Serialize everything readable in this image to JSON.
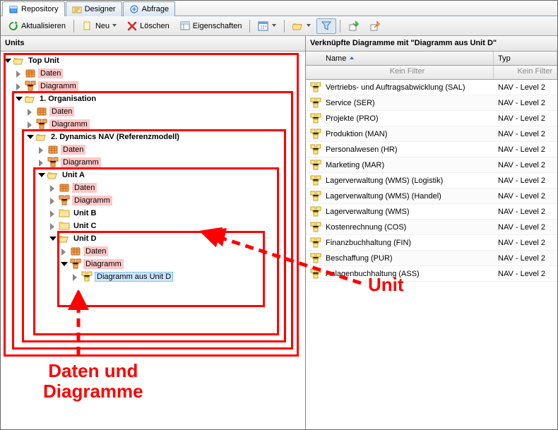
{
  "tabs": [
    {
      "label": "Repository",
      "active": true
    },
    {
      "label": "Designer",
      "active": false
    },
    {
      "label": "Abfrage",
      "active": false
    }
  ],
  "toolbar": {
    "refresh": "Aktualisieren",
    "new": "Neu",
    "delete": "Löschen",
    "props": "Eigenschaften"
  },
  "left": {
    "title": "Units",
    "tree": {
      "topUnit": "Top Unit",
      "daten": "Daten",
      "diagramm": "Diagramm",
      "org": "1. Organisation",
      "nav": "2. Dynamics NAV (Referenzmodell)",
      "unitA": "Unit A",
      "unitB": "Unit B",
      "unitC": "Unit C",
      "unitD": "Unit D",
      "diagFromD": "Diagramm aus Unit D"
    }
  },
  "right": {
    "title": "Verknüpfte Diagramme mit \"Diagramm aus Unit D\"",
    "colName": "Name",
    "colTyp": "Typ",
    "filterText": "Kein Filter",
    "rows": [
      {
        "name": "Vertriebs- und Auftragsabwicklung (SAL)",
        "typ": "NAV - Level 2"
      },
      {
        "name": "Service (SER)",
        "typ": "NAV - Level 2"
      },
      {
        "name": "Projekte (PRO)",
        "typ": "NAV - Level 2"
      },
      {
        "name": "Produktion (MAN)",
        "typ": "NAV - Level 2"
      },
      {
        "name": "Personalwesen (HR)",
        "typ": "NAV - Level 2"
      },
      {
        "name": "Marketing (MAR)",
        "typ": "NAV - Level 2"
      },
      {
        "name": "Lagerverwaltung (WMS) (Logistik)",
        "typ": "NAV - Level 2"
      },
      {
        "name": "Lagerverwaltung (WMS) (Handel)",
        "typ": "NAV - Level 2"
      },
      {
        "name": "Lagerverwaltung (WMS)",
        "typ": "NAV - Level 2"
      },
      {
        "name": "Kostenrechnung (COS)",
        "typ": "NAV - Level 2"
      },
      {
        "name": "Finanzbuchhaltung (FIN)",
        "typ": "NAV - Level 2"
      },
      {
        "name": "Beschaffung (PUR)",
        "typ": "NAV - Level 2"
      },
      {
        "name": "Anlagenbuchhaltung (ASS)",
        "typ": "NAV - Level 2"
      }
    ]
  },
  "annotations": {
    "unit": "Unit",
    "datenDiagramme": "Daten und\nDiagramme"
  }
}
